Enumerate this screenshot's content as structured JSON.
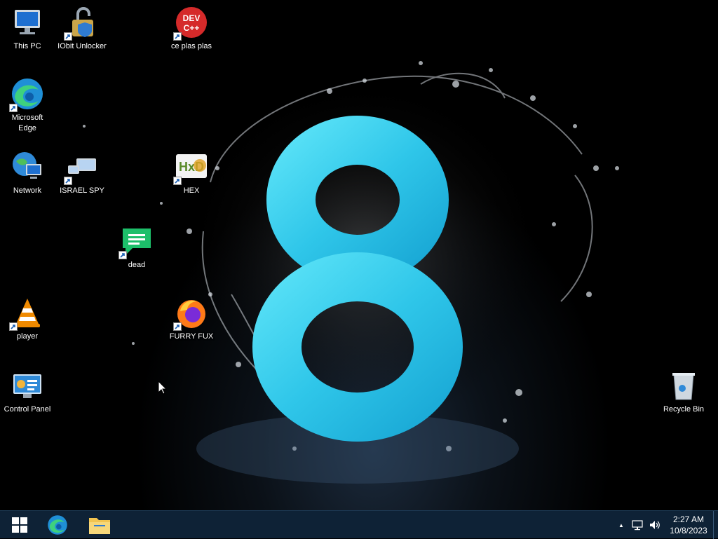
{
  "desktop": {
    "wallpaper_text": "8",
    "icons": [
      {
        "label": "This PC"
      },
      {
        "label": "IObit Unlocker"
      },
      {
        "label": "ce plas plas"
      },
      {
        "label": "Microsoft\nEdge"
      },
      {
        "label": "Network"
      },
      {
        "label": "ISRAEL SPY"
      },
      {
        "label": "HEX"
      },
      {
        "label": "dead"
      },
      {
        "label": "player"
      },
      {
        "label": "FURRY FUX"
      },
      {
        "label": "Control Panel"
      },
      {
        "label": "Recycle Bin"
      }
    ],
    "dev_icon_text": "DEV C++",
    "hxd_icon_text": "HxD"
  },
  "taskbar": {
    "tray_overflow": "▲",
    "clock": {
      "time": "2:27 AM",
      "date": "10/8/2023"
    }
  },
  "colors": {
    "taskbar": "#0e2236",
    "wallpaper_accent": "#3fd0ef"
  }
}
